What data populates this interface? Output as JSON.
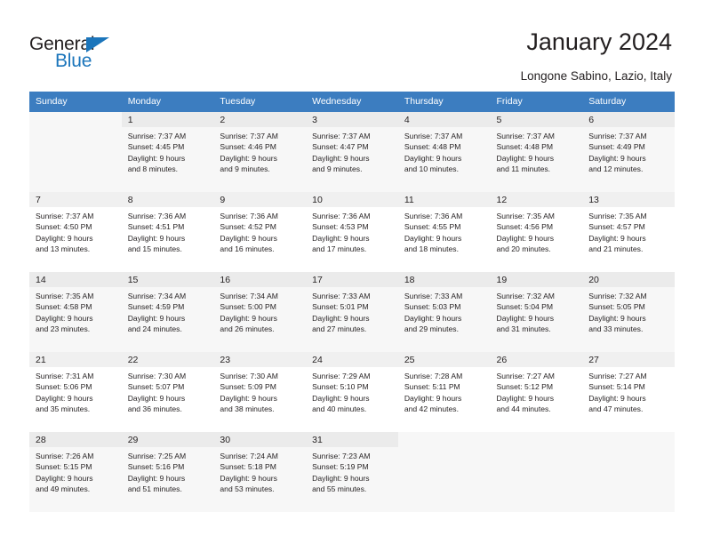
{
  "brand": {
    "name_top": "General",
    "name_bottom": "Blue",
    "accent_color": "#1b75bb",
    "triangle_icon": "brand-triangle-icon"
  },
  "header": {
    "title": "January 2024",
    "subtitle": "Longone Sabino, Lazio, Italy"
  },
  "calendar": {
    "header_background": "#3c7dc0",
    "weekday_headers": [
      "Sunday",
      "Monday",
      "Tuesday",
      "Wednesday",
      "Thursday",
      "Friday",
      "Saturday"
    ],
    "weeks": [
      [
        {
          "day": "",
          "sunrise": "",
          "sunset": "",
          "daylight_1": "",
          "daylight_2": ""
        },
        {
          "day": "1",
          "sunrise": "Sunrise: 7:37 AM",
          "sunset": "Sunset: 4:45 PM",
          "daylight_1": "Daylight: 9 hours",
          "daylight_2": "and 8 minutes."
        },
        {
          "day": "2",
          "sunrise": "Sunrise: 7:37 AM",
          "sunset": "Sunset: 4:46 PM",
          "daylight_1": "Daylight: 9 hours",
          "daylight_2": "and 9 minutes."
        },
        {
          "day": "3",
          "sunrise": "Sunrise: 7:37 AM",
          "sunset": "Sunset: 4:47 PM",
          "daylight_1": "Daylight: 9 hours",
          "daylight_2": "and 9 minutes."
        },
        {
          "day": "4",
          "sunrise": "Sunrise: 7:37 AM",
          "sunset": "Sunset: 4:48 PM",
          "daylight_1": "Daylight: 9 hours",
          "daylight_2": "and 10 minutes."
        },
        {
          "day": "5",
          "sunrise": "Sunrise: 7:37 AM",
          "sunset": "Sunset: 4:48 PM",
          "daylight_1": "Daylight: 9 hours",
          "daylight_2": "and 11 minutes."
        },
        {
          "day": "6",
          "sunrise": "Sunrise: 7:37 AM",
          "sunset": "Sunset: 4:49 PM",
          "daylight_1": "Daylight: 9 hours",
          "daylight_2": "and 12 minutes."
        }
      ],
      [
        {
          "day": "7",
          "sunrise": "Sunrise: 7:37 AM",
          "sunset": "Sunset: 4:50 PM",
          "daylight_1": "Daylight: 9 hours",
          "daylight_2": "and 13 minutes."
        },
        {
          "day": "8",
          "sunrise": "Sunrise: 7:36 AM",
          "sunset": "Sunset: 4:51 PM",
          "daylight_1": "Daylight: 9 hours",
          "daylight_2": "and 15 minutes."
        },
        {
          "day": "9",
          "sunrise": "Sunrise: 7:36 AM",
          "sunset": "Sunset: 4:52 PM",
          "daylight_1": "Daylight: 9 hours",
          "daylight_2": "and 16 minutes."
        },
        {
          "day": "10",
          "sunrise": "Sunrise: 7:36 AM",
          "sunset": "Sunset: 4:53 PM",
          "daylight_1": "Daylight: 9 hours",
          "daylight_2": "and 17 minutes."
        },
        {
          "day": "11",
          "sunrise": "Sunrise: 7:36 AM",
          "sunset": "Sunset: 4:55 PM",
          "daylight_1": "Daylight: 9 hours",
          "daylight_2": "and 18 minutes."
        },
        {
          "day": "12",
          "sunrise": "Sunrise: 7:35 AM",
          "sunset": "Sunset: 4:56 PM",
          "daylight_1": "Daylight: 9 hours",
          "daylight_2": "and 20 minutes."
        },
        {
          "day": "13",
          "sunrise": "Sunrise: 7:35 AM",
          "sunset": "Sunset: 4:57 PM",
          "daylight_1": "Daylight: 9 hours",
          "daylight_2": "and 21 minutes."
        }
      ],
      [
        {
          "day": "14",
          "sunrise": "Sunrise: 7:35 AM",
          "sunset": "Sunset: 4:58 PM",
          "daylight_1": "Daylight: 9 hours",
          "daylight_2": "and 23 minutes."
        },
        {
          "day": "15",
          "sunrise": "Sunrise: 7:34 AM",
          "sunset": "Sunset: 4:59 PM",
          "daylight_1": "Daylight: 9 hours",
          "daylight_2": "and 24 minutes."
        },
        {
          "day": "16",
          "sunrise": "Sunrise: 7:34 AM",
          "sunset": "Sunset: 5:00 PM",
          "daylight_1": "Daylight: 9 hours",
          "daylight_2": "and 26 minutes."
        },
        {
          "day": "17",
          "sunrise": "Sunrise: 7:33 AM",
          "sunset": "Sunset: 5:01 PM",
          "daylight_1": "Daylight: 9 hours",
          "daylight_2": "and 27 minutes."
        },
        {
          "day": "18",
          "sunrise": "Sunrise: 7:33 AM",
          "sunset": "Sunset: 5:03 PM",
          "daylight_1": "Daylight: 9 hours",
          "daylight_2": "and 29 minutes."
        },
        {
          "day": "19",
          "sunrise": "Sunrise: 7:32 AM",
          "sunset": "Sunset: 5:04 PM",
          "daylight_1": "Daylight: 9 hours",
          "daylight_2": "and 31 minutes."
        },
        {
          "day": "20",
          "sunrise": "Sunrise: 7:32 AM",
          "sunset": "Sunset: 5:05 PM",
          "daylight_1": "Daylight: 9 hours",
          "daylight_2": "and 33 minutes."
        }
      ],
      [
        {
          "day": "21",
          "sunrise": "Sunrise: 7:31 AM",
          "sunset": "Sunset: 5:06 PM",
          "daylight_1": "Daylight: 9 hours",
          "daylight_2": "and 35 minutes."
        },
        {
          "day": "22",
          "sunrise": "Sunrise: 7:30 AM",
          "sunset": "Sunset: 5:07 PM",
          "daylight_1": "Daylight: 9 hours",
          "daylight_2": "and 36 minutes."
        },
        {
          "day": "23",
          "sunrise": "Sunrise: 7:30 AM",
          "sunset": "Sunset: 5:09 PM",
          "daylight_1": "Daylight: 9 hours",
          "daylight_2": "and 38 minutes."
        },
        {
          "day": "24",
          "sunrise": "Sunrise: 7:29 AM",
          "sunset": "Sunset: 5:10 PM",
          "daylight_1": "Daylight: 9 hours",
          "daylight_2": "and 40 minutes."
        },
        {
          "day": "25",
          "sunrise": "Sunrise: 7:28 AM",
          "sunset": "Sunset: 5:11 PM",
          "daylight_1": "Daylight: 9 hours",
          "daylight_2": "and 42 minutes."
        },
        {
          "day": "26",
          "sunrise": "Sunrise: 7:27 AM",
          "sunset": "Sunset: 5:12 PM",
          "daylight_1": "Daylight: 9 hours",
          "daylight_2": "and 44 minutes."
        },
        {
          "day": "27",
          "sunrise": "Sunrise: 7:27 AM",
          "sunset": "Sunset: 5:14 PM",
          "daylight_1": "Daylight: 9 hours",
          "daylight_2": "and 47 minutes."
        }
      ],
      [
        {
          "day": "28",
          "sunrise": "Sunrise: 7:26 AM",
          "sunset": "Sunset: 5:15 PM",
          "daylight_1": "Daylight: 9 hours",
          "daylight_2": "and 49 minutes."
        },
        {
          "day": "29",
          "sunrise": "Sunrise: 7:25 AM",
          "sunset": "Sunset: 5:16 PM",
          "daylight_1": "Daylight: 9 hours",
          "daylight_2": "and 51 minutes."
        },
        {
          "day": "30",
          "sunrise": "Sunrise: 7:24 AM",
          "sunset": "Sunset: 5:18 PM",
          "daylight_1": "Daylight: 9 hours",
          "daylight_2": "and 53 minutes."
        },
        {
          "day": "31",
          "sunrise": "Sunrise: 7:23 AM",
          "sunset": "Sunset: 5:19 PM",
          "daylight_1": "Daylight: 9 hours",
          "daylight_2": "and 55 minutes."
        },
        {
          "day": "",
          "sunrise": "",
          "sunset": "",
          "daylight_1": "",
          "daylight_2": ""
        },
        {
          "day": "",
          "sunrise": "",
          "sunset": "",
          "daylight_1": "",
          "daylight_2": ""
        },
        {
          "day": "",
          "sunrise": "",
          "sunset": "",
          "daylight_1": "",
          "daylight_2": ""
        }
      ]
    ]
  }
}
